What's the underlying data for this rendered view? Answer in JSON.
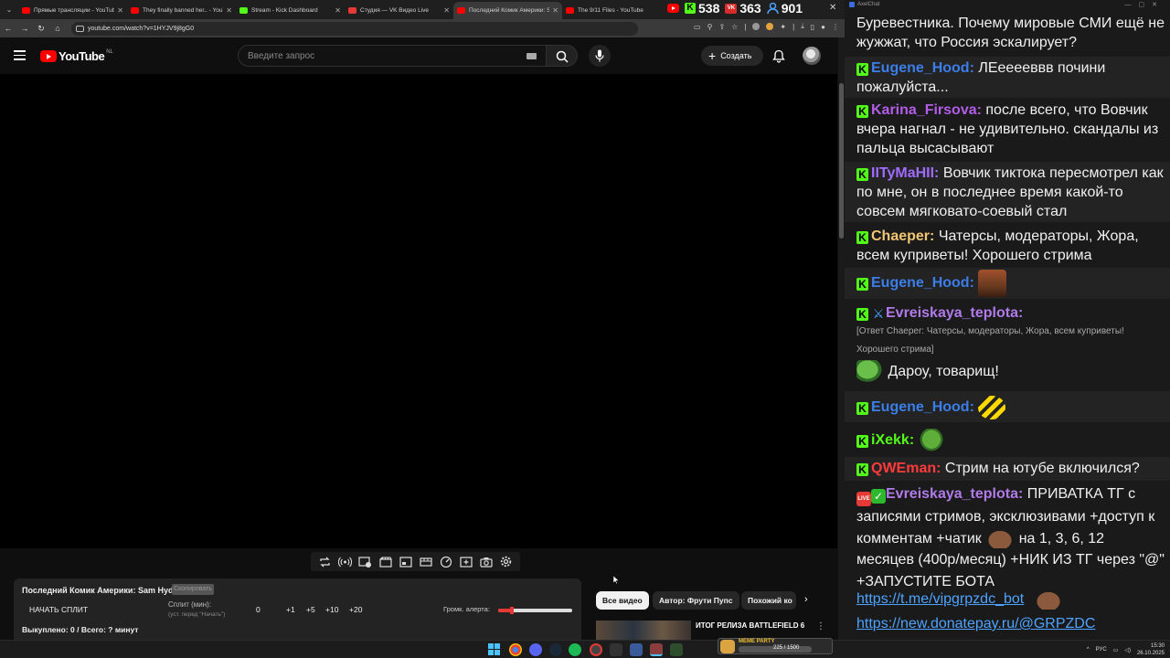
{
  "browser": {
    "tabs": [
      {
        "title": "Прямые трансляции - YouTube",
        "favicon_color": "#ff0000"
      },
      {
        "title": "They finally banned her.. - YouTube",
        "favicon_color": "#ff0000"
      },
      {
        "title": "Stream - Kick Dashboard",
        "favicon_color": "#53fc18"
      },
      {
        "title": "Студия — VK Видео Live",
        "favicon_color": "#e53935"
      },
      {
        "title": "Последний Комик Америки: Sam Hyde",
        "favicon_color": "#ff0000"
      },
      {
        "title": "The 9/11 Files - YouTube",
        "favicon_color": "#ff0000"
      }
    ],
    "url": "youtube.com/watch?v=1HYJV9j8gG0"
  },
  "stream_counters": {
    "kick": "538",
    "vk": "363",
    "viewers": "901",
    "vk_icon_label": "VK"
  },
  "youtube": {
    "logo_text": "YouTube",
    "region": "NL",
    "search_placeholder": "Введите запрос",
    "create_label": "Создать"
  },
  "split_widget": {
    "title": "Последний Комик Америки: Sam Hyde",
    "badge": "Скопировать",
    "start_label": "НАЧАТЬ СПЛИТ",
    "split_label": "Сплит (мин):",
    "split_hint": "(уст. перед \"Начать\")",
    "zero": "0",
    "increments": [
      "+1",
      "+5",
      "+10",
      "+20"
    ],
    "volume_label": "Громк. алерта:",
    "volume_level": 0.18,
    "footer": "Выкуплено: 0 / Всего: ? минут"
  },
  "chips": [
    "Все видео",
    "Автор: Фрути Пупс",
    "Похожий ко"
  ],
  "recommendation": {
    "title": "ИТОГ РЕЛИЗА BATTLEFIELD 6"
  },
  "chat": {
    "window_title": "AxelChat",
    "messages": [
      {
        "user": "",
        "text": "Буревестника. Почему мировые СМИ ещё не жужжат, что Россия эскалирует?"
      },
      {
        "user": "Eugene_Hood:",
        "user_color": "#3c7ee8",
        "text": "ЛЕееееввв почини пожалуйста..."
      },
      {
        "user": "Karina_Firsova:",
        "user_color": "#b25ce8",
        "text": "после всего, что Вовчик вчера нагнал - не удивительно. скандалы из пальца высасывают"
      },
      {
        "user": "IITyMaHII:",
        "user_color": "#a06bff",
        "text": "Вовчик тиктока пересмотрел как по мне, он в последнее время какой-то совсем мягковато-соевый стал"
      },
      {
        "user": "Chaeper:",
        "user_color": "#f0c674",
        "text": "Чатерсы, модераторы, Жора, всем куприветы! Хорошего стрима"
      },
      {
        "user": "Eugene_Hood:",
        "user_color": "#3c7ee8",
        "text": ""
      },
      {
        "user": "Evreiskaya_teplota:",
        "user_color": "#b07be8",
        "text": "",
        "reply": "[Ответ Chaeper: Чатерсы, модераторы, Жора, всем куприветы! Хорошего стрима]"
      },
      {
        "user": "",
        "text": "Дароу, товарищ!"
      },
      {
        "user": "Eugene_Hood:",
        "user_color": "#3c7ee8",
        "text": ""
      },
      {
        "user": "iXekk:",
        "user_color": "#53fc18",
        "text": ""
      },
      {
        "user": "QWEman:",
        "user_color": "#ff3b3b",
        "text": "Стрим на ютубе включился?"
      },
      {
        "user": "Evreiskaya_teplota:",
        "user_color": "#b07be8",
        "text": "ПРИВАТКА ТГ с записями стримов, эксклюзивами +доступ к комментам +чатик",
        "text2": "на 1, 3, 6, 12 месяцев (400р/месяц) +НИК ИЗ ТГ через \"@\" +ЗАПУСТИТЕ БОТА"
      },
      {
        "user": "",
        "text": "https://t.me/vipgrpzdc_bot"
      },
      {
        "user": "",
        "text": "https://new.donatepay.ru/@GRPZDC"
      }
    ]
  },
  "taskbar": {
    "widget_label": "MEME PARTY",
    "widget_count": "225 / 1500",
    "lang": "РУС",
    "time": "15:30",
    "date": "26.10.2025"
  }
}
